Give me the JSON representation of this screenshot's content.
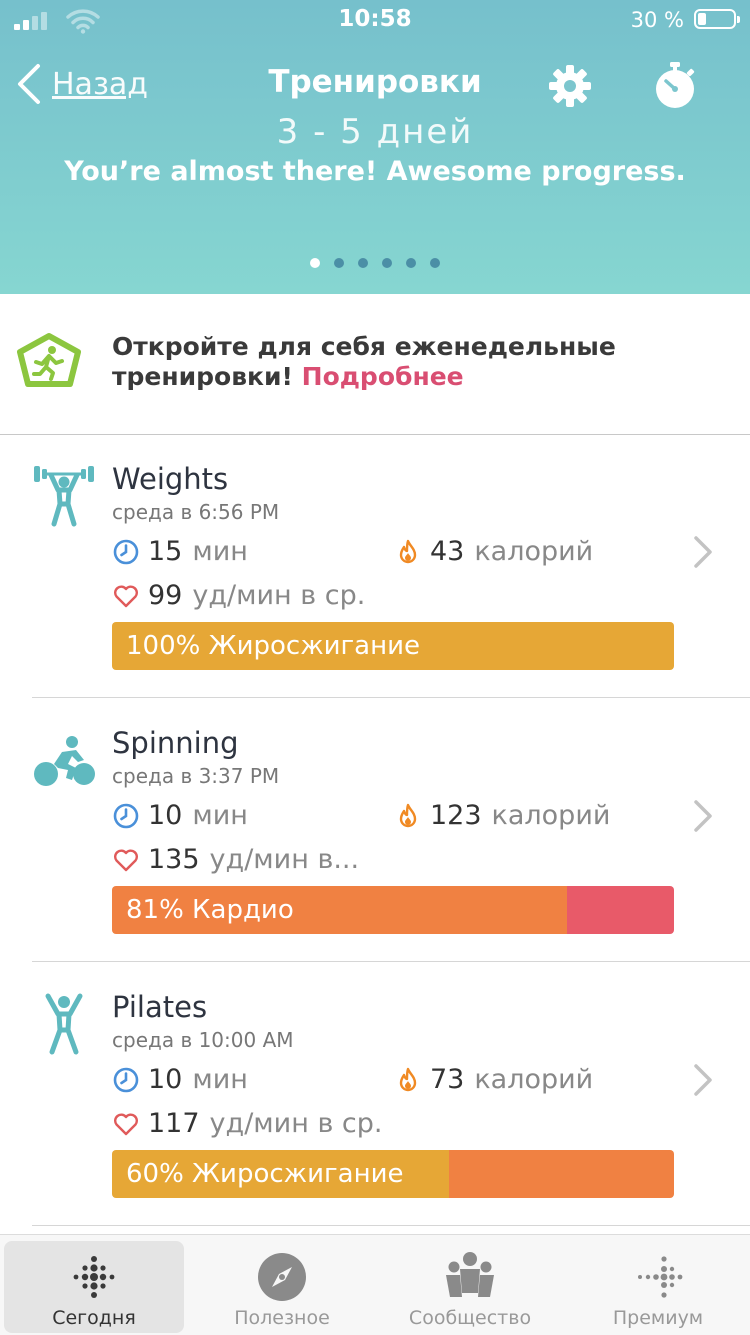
{
  "status_bar": {
    "time": "10:58",
    "battery": "30 %"
  },
  "nav": {
    "back_label": "Назад",
    "title": "Тренировки"
  },
  "hero": {
    "headline": "3 - 5 дней",
    "subtitle": "You’re almost there! Awesome progress.",
    "page_count": 6,
    "active_page": 0
  },
  "promo": {
    "text": "Откройте для себя еженедельные тренировки!",
    "link": "Подробнее"
  },
  "workouts": [
    {
      "name": "Weights",
      "time": "среда в 6:56 PM",
      "duration": "15",
      "duration_unit": "мин",
      "calories": "43",
      "calories_unit": "калорий",
      "hr": "99",
      "hr_unit": "уд/мин в ср.",
      "zone_label": "100% Жиросжигание",
      "icon": "weightlifting-icon",
      "zones": [
        {
          "name": "fat-burn",
          "fraction": 1.0,
          "color": "#e6a736"
        }
      ]
    },
    {
      "name": "Spinning",
      "time": "среда в 3:37 PM",
      "duration": "10",
      "duration_unit": "мин",
      "calories": "123",
      "calories_unit": "калорий",
      "hr": "135",
      "hr_unit": "уд/мин в...",
      "zone_label": "81% Кардио",
      "icon": "cycling-icon",
      "zones": [
        {
          "name": "cardio",
          "fraction": 0.81,
          "color": "#f08142"
        },
        {
          "name": "peak",
          "fraction": 0.19,
          "color": "#e85a69"
        }
      ]
    },
    {
      "name": "Pilates",
      "time": "среда в 10:00 AM",
      "duration": "10",
      "duration_unit": "мин",
      "calories": "73",
      "calories_unit": "калорий",
      "hr": "117",
      "hr_unit": "уд/мин в ср.",
      "zone_label": "60% Жиросжигание",
      "icon": "pilates-icon",
      "zones": [
        {
          "name": "fat-burn",
          "fraction": 0.6,
          "color": "#e6a736"
        },
        {
          "name": "cardio",
          "fraction": 0.4,
          "color": "#f08142"
        }
      ]
    }
  ],
  "tabs": [
    {
      "label": "Сегодня",
      "icon": "today-icon",
      "active": true
    },
    {
      "label": "Полезное",
      "icon": "compass-icon",
      "active": false
    },
    {
      "label": "Сообщество",
      "icon": "community-icon",
      "active": false
    },
    {
      "label": "Премиум",
      "icon": "premium-icon",
      "active": false
    }
  ],
  "colors": {
    "header_top": "#76c0cc",
    "header_bottom": "#86d6d1",
    "accent_link": "#d94e72",
    "teal_icon": "#5fb9bf",
    "promo_badge": "#8cc63f"
  }
}
